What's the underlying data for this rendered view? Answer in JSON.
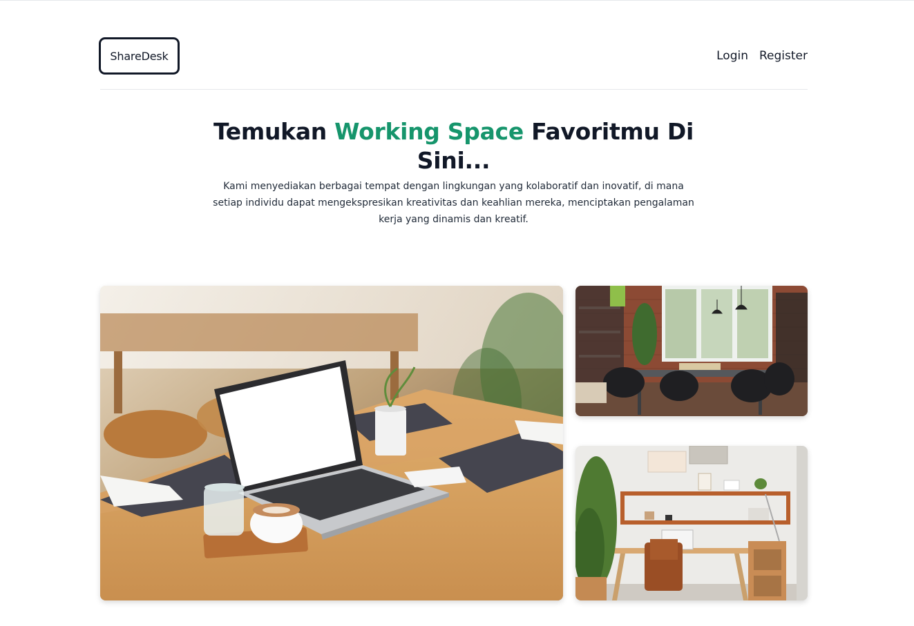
{
  "brand": {
    "name": "ShareDesk"
  },
  "nav": {
    "login_label": "Login",
    "register_label": "Register"
  },
  "hero": {
    "title_prefix": "Temukan ",
    "title_accent": "Working Space",
    "title_suffix": " Favoritmu Di Sini...",
    "subtitle": "Kami menyediakan berbagai tempat dengan lingkungan yang kolaboratif dan inovatif, di mana setiap individu dapat mengekspresikan kreativitas dan keahlian mereka, menciptakan pengalaman kerja yang dinamis dan kreatif."
  },
  "colors": {
    "accent": "#16956c",
    "text": "#111827",
    "divider": "#e5e7eb"
  },
  "gallery": {
    "photos": [
      "workspace-laptop-table",
      "coworking-room-brick",
      "home-office-desk"
    ]
  }
}
